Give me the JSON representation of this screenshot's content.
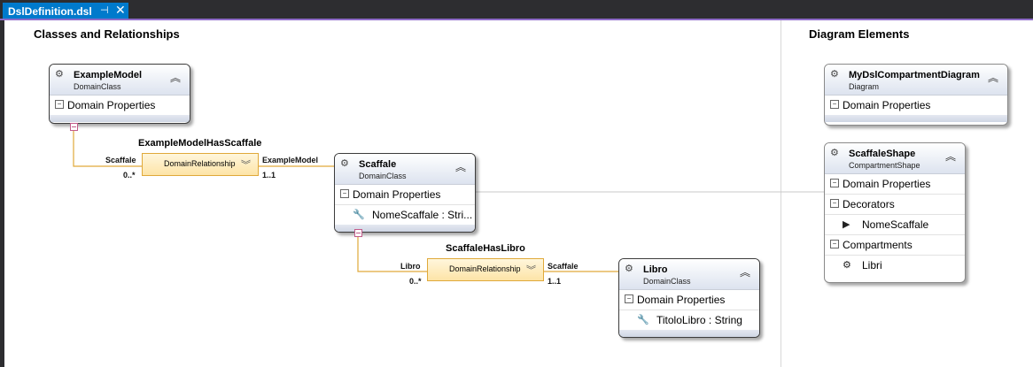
{
  "tab": {
    "title": "DslDefinition.dsl",
    "pin": "⊣",
    "close": "✕"
  },
  "sections": {
    "left_title": "Classes and Relationships",
    "right_title": "Diagram Elements"
  },
  "classes": {
    "example_model": {
      "name": "ExampleModel",
      "kind": "DomainClass",
      "compartment": "Domain Properties"
    },
    "scaffale": {
      "name": "Scaffale",
      "kind": "DomainClass",
      "compartment": "Domain Properties",
      "property": "NomeScaffale : Stri..."
    },
    "libro": {
      "name": "Libro",
      "kind": "DomainClass",
      "compartment": "Domain Properties",
      "property": "TitoloLibro : String"
    }
  },
  "relationships": {
    "r1": {
      "name": "ExampleModelHasScaffale",
      "kind": "DomainRelationship",
      "source_role": "Scaffale",
      "source_mult": "0..*",
      "target_role": "ExampleModel",
      "target_mult": "1..1"
    },
    "r2": {
      "name": "ScaffaleHasLibro",
      "kind": "DomainRelationship",
      "source_role": "Libro",
      "source_mult": "0..*",
      "target_role": "Scaffale",
      "target_mult": "1..1"
    }
  },
  "diagram_elements": {
    "diagram": {
      "name": "MyDslCompartmentDiagram",
      "kind": "Diagram",
      "compartment": "Domain Properties"
    },
    "shape": {
      "name": "ScaffaleShape",
      "kind": "CompartmentShape",
      "domain_props": "Domain Properties",
      "decorators": "Decorators",
      "decorator_item": "NomeScaffale",
      "compartments": "Compartments",
      "compartment_item": "Libri"
    }
  },
  "icons": {
    "class": "class-icon",
    "chevron": "chevron-up-icon",
    "wrench": "wrench-icon",
    "tag": "tag-icon",
    "compartment": "compartment-shape-icon"
  },
  "colors": {
    "accent": "#007acc",
    "tab_underline": "#8e6bc8",
    "relationship_fill": "#fde4a7",
    "connector": "#e0a93a",
    "embed_marker": "#c25c8a"
  }
}
